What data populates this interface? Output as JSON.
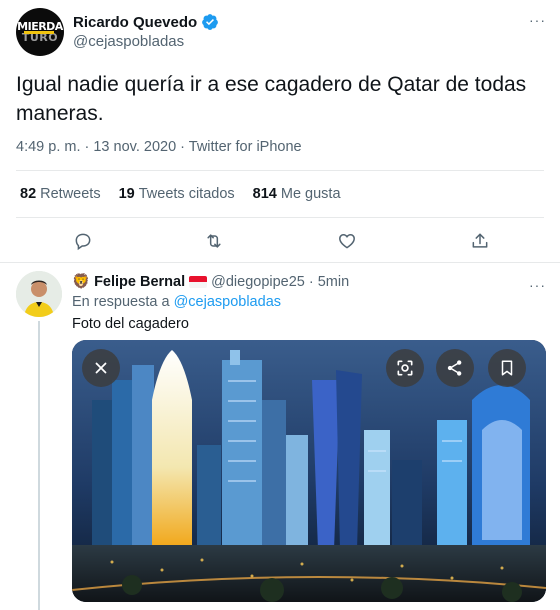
{
  "tweet": {
    "author_name": "Ricardo Quevedo",
    "author_handle": "@cejaspobladas",
    "avatar_text_top": "MIERDA",
    "avatar_text_bottom": "TURO",
    "text": "Igual nadie quería ir a ese cagadero de Qatar de todas maneras.",
    "meta": "4:49 p. m. · 13 nov. 2020 · Twitter for iPhone",
    "stats": [
      {
        "count": "82",
        "label": "Retweets"
      },
      {
        "count": "19",
        "label": "Tweets citados"
      },
      {
        "count": "814",
        "label": "Me gusta"
      }
    ],
    "more_icon": "···",
    "actions": [
      "reply-icon",
      "retweet-icon",
      "like-icon",
      "share-icon"
    ]
  },
  "reply": {
    "emoji": "🦁",
    "name": "Felipe Bernal",
    "handle": "@diegopipe25",
    "time": "· 5min",
    "replying_prefix": "En respuesta a",
    "replying_to": "@cejaspobladas",
    "text": "Foto del cagadero",
    "more_icon": "···",
    "photo_overlay": [
      "close-icon",
      "search-icon",
      "share-icon",
      "bookmark-icon"
    ]
  },
  "colors": {
    "text": "#0f1419",
    "secondary": "#536471",
    "accent": "#1d9bf0",
    "divider": "#e7e9ea"
  }
}
